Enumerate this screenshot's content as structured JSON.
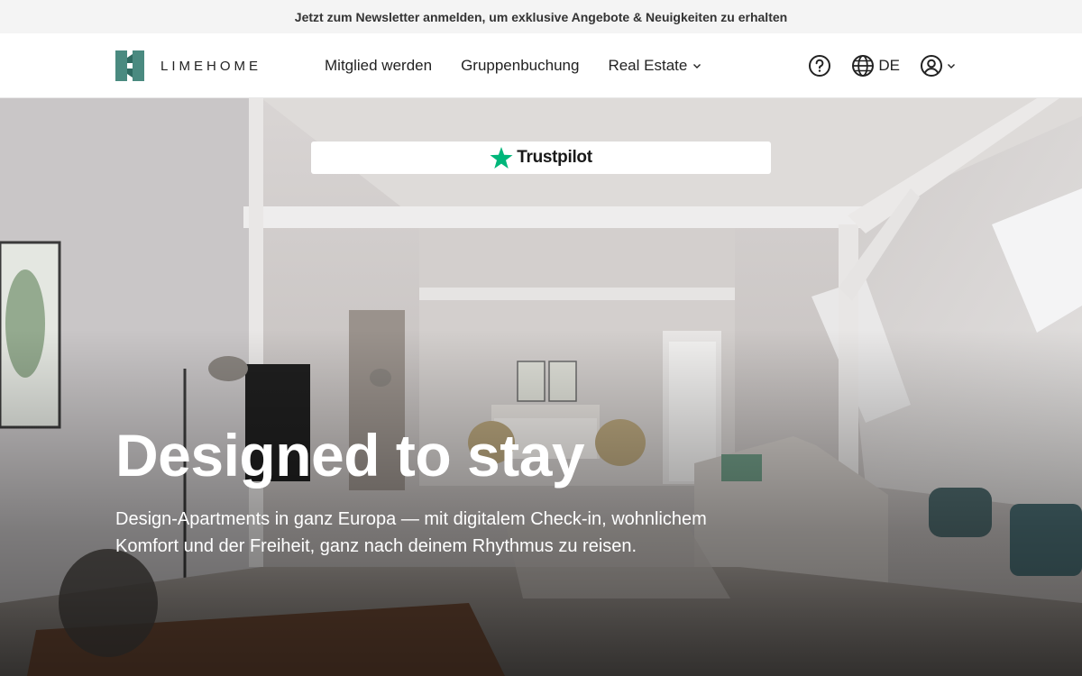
{
  "announcement": {
    "text": "Jetzt zum Newsletter anmelden, um exklusive Angebote & Neuigkeiten zu erhalten"
  },
  "header": {
    "logo_text": "LIMEHOME",
    "nav": [
      {
        "label": "Mitglied werden"
      },
      {
        "label": "Gruppenbuchung"
      },
      {
        "label": "Real Estate"
      }
    ],
    "language": "DE",
    "icons": {
      "help": "help-circle-icon",
      "language": "globe-icon",
      "account": "user-circle-icon"
    }
  },
  "hero": {
    "trustpilot_label": "Trustpilot",
    "title": "Designed to stay",
    "subtitle": "Design-Apartments in ganz Europa — mit digitalem Check-in, wohnlichem Komfort und der Freiheit, ganz nach deinem Rhythmus zu reisen."
  },
  "colors": {
    "brand": "#4a8a80",
    "trustpilot_star": "#00b67a",
    "topbar_bg": "#f4f4f4"
  }
}
